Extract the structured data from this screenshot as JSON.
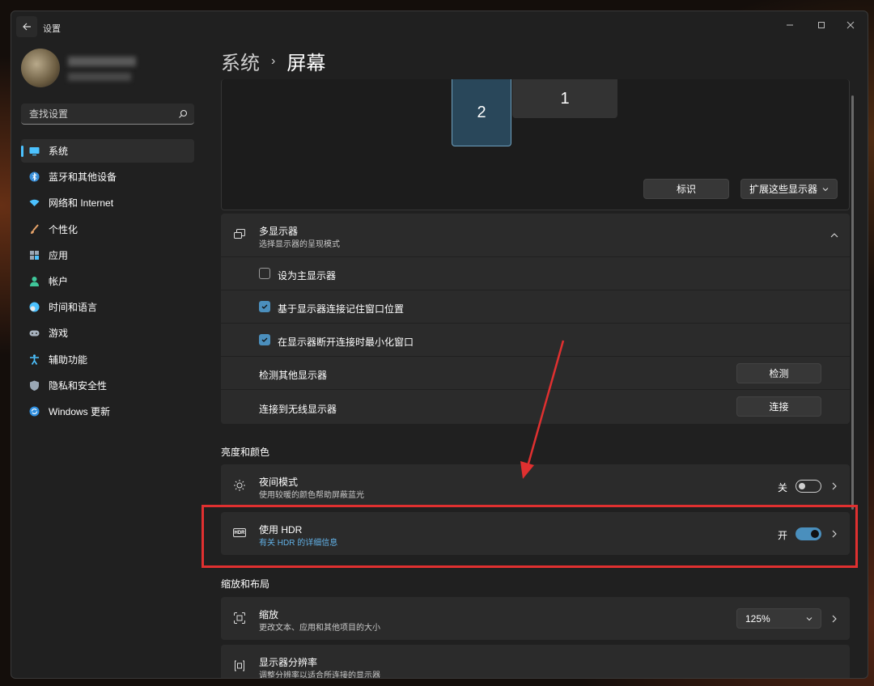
{
  "window": {
    "title": "设置",
    "controls": [
      "minimize",
      "maximize",
      "close"
    ]
  },
  "search": {
    "placeholder": "查找设置"
  },
  "sidebar": {
    "items": [
      {
        "label": "系统",
        "icon": "system-icon",
        "active": true
      },
      {
        "label": "蓝牙和其他设备",
        "icon": "bluetooth-icon"
      },
      {
        "label": "网络和 Internet",
        "icon": "wifi-icon"
      },
      {
        "label": "个性化",
        "icon": "brush-icon"
      },
      {
        "label": "应用",
        "icon": "apps-icon"
      },
      {
        "label": "帐户",
        "icon": "account-icon"
      },
      {
        "label": "时间和语言",
        "icon": "globe-icon"
      },
      {
        "label": "游戏",
        "icon": "gamepad-icon"
      },
      {
        "label": "辅助功能",
        "icon": "accessibility-icon"
      },
      {
        "label": "隐私和安全性",
        "icon": "shield-icon"
      },
      {
        "label": "Windows 更新",
        "icon": "update-icon"
      }
    ]
  },
  "breadcrumb": {
    "parent": "系统",
    "separator": "›",
    "current": "屏幕"
  },
  "monitors": {
    "monitor_2": "2",
    "monitor_1": "1",
    "identify_label": "标识",
    "mode_value": "扩展这些显示器"
  },
  "multi_display": {
    "title": "多显示器",
    "subtitle": "选择显示器的呈现模式",
    "options": [
      {
        "label": "设为主显示器",
        "checked": false
      },
      {
        "label": "基于显示器连接记住窗口位置",
        "checked": true
      },
      {
        "label": "在显示器断开连接时最小化窗口",
        "checked": true
      }
    ],
    "detect": {
      "label": "检测其他显示器",
      "button": "检测"
    },
    "wireless": {
      "label": "连接到无线显示器",
      "button": "连接"
    }
  },
  "brightness_section": {
    "heading": "亮度和颜色",
    "night_light": {
      "title": "夜间模式",
      "subtitle": "使用较暖的颜色帮助屏蔽蓝光",
      "state": "关",
      "on": false
    },
    "hdr": {
      "title": "使用 HDR",
      "link": "有关 HDR 的详细信息",
      "state": "开",
      "on": true,
      "icon_text": "HDR"
    }
  },
  "scale_section": {
    "heading": "缩放和布局",
    "scale": {
      "title": "缩放",
      "subtitle": "更改文本、应用和其他项目的大小",
      "value": "125%"
    },
    "resolution": {
      "title": "显示器分辨率",
      "subtitle": "调整分辨率以适合所连接的显示器"
    }
  },
  "colors": {
    "accent": "#4cc2ff",
    "toggle_on": "#4a8fbd",
    "annotation_red": "#e03030"
  }
}
